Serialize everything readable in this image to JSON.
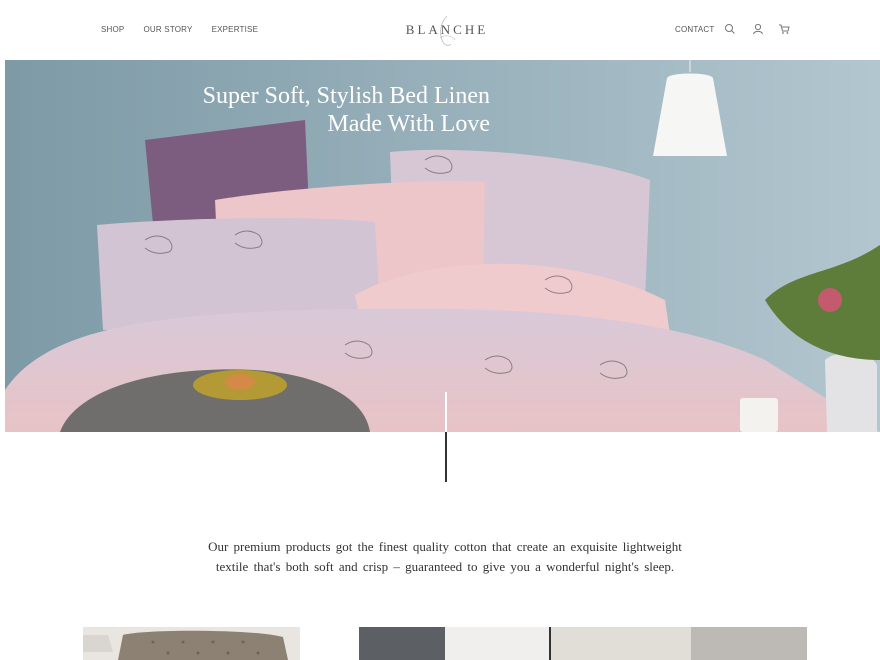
{
  "header": {
    "nav_left": [
      "SHOP",
      "OUR STORY",
      "EXPERTISE"
    ],
    "logo": "BLANCHE",
    "contact_label": "CONTACT",
    "icons": [
      "search-icon",
      "user-icon",
      "cart-icon"
    ]
  },
  "hero": {
    "title_line1": "Super Soft, Stylish Bed Linen",
    "title_line2": "Made With Love"
  },
  "intro": {
    "text": "Our premium products got the finest quality cotton that create an exquisite lightweight textile that's both soft and crisp – guaranteed to give you a wonderful night's sleep."
  },
  "colors": {
    "wall": "#86a2ad",
    "pink_bedding": "#e9c6c9",
    "lavender_bedding": "#d3c6d4",
    "plum_pillow": "#7d5e80",
    "text_dark": "#333333"
  }
}
